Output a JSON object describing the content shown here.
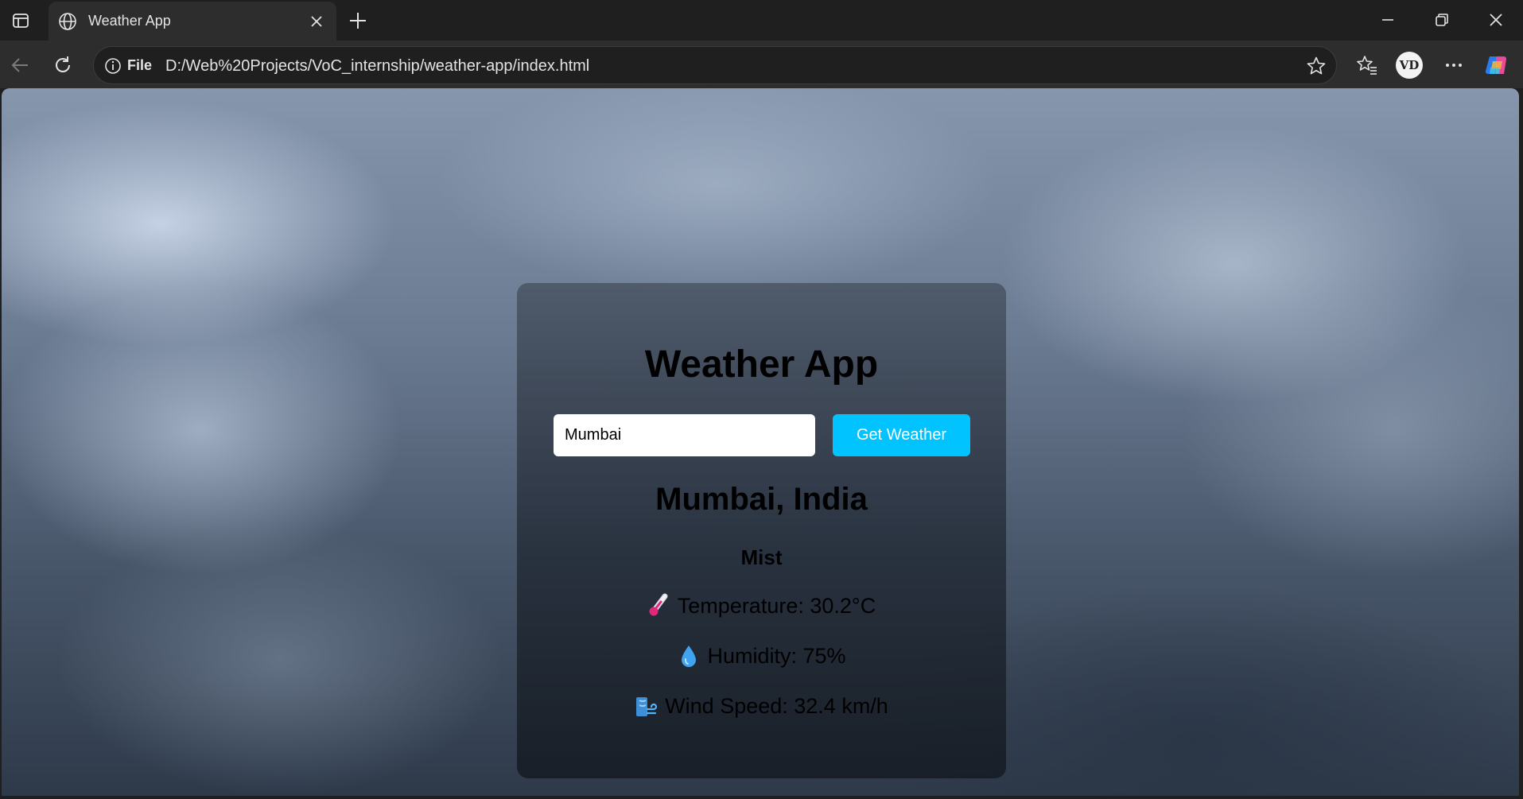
{
  "browser": {
    "tab_title": "Weather App",
    "url_scheme": "File",
    "url": "D:/Web%20Projects/VoC_internship/weather-app/index.html",
    "avatar_initials": "VD"
  },
  "app": {
    "title": "Weather App",
    "city_input_value": "Mumbai",
    "button_label": "Get Weather",
    "location": "Mumbai, India",
    "condition": "Mist",
    "temperature": "Temperature: 30.2°C",
    "humidity": "Humidity: 75%",
    "wind_speed": "Wind Speed: 32.4 km/h",
    "icons": [
      "thermometer-icon",
      "droplet-icon",
      "wind-icon"
    ],
    "accent_color": "#00c3ff"
  }
}
